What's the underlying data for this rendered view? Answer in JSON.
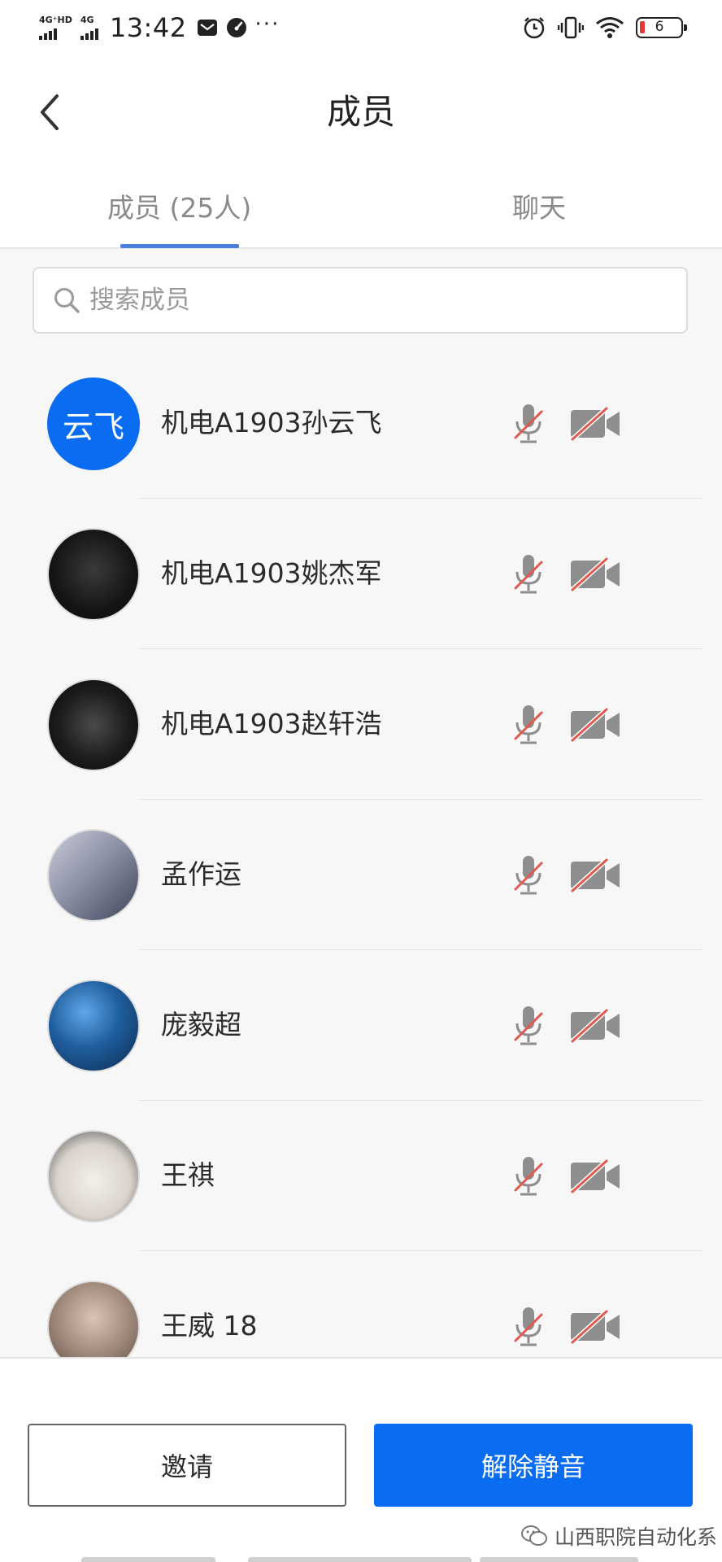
{
  "status_bar": {
    "net1": "4G⁺HD",
    "net2": "4G",
    "time": "13:42",
    "dots": "···",
    "battery": "6"
  },
  "header": {
    "title": "成员"
  },
  "tabs": [
    {
      "label": "成员 (25人)",
      "selected": true
    },
    {
      "label": "聊天",
      "selected": false
    }
  ],
  "search": {
    "placeholder": "搜索成员",
    "value": ""
  },
  "members": [
    {
      "name": "机电A1903孙云飞",
      "avatar_text": "云飞",
      "mic": "muted",
      "camera": "off"
    },
    {
      "name": "机电A1903姚杰军",
      "mic": "muted",
      "camera": "off"
    },
    {
      "name": "机电A1903赵轩浩",
      "mic": "muted",
      "camera": "off"
    },
    {
      "name": "孟作运",
      "mic": "muted",
      "camera": "off"
    },
    {
      "name": "庞毅超",
      "mic": "muted",
      "camera": "off"
    },
    {
      "name": "王祺",
      "mic": "muted",
      "camera": "off"
    },
    {
      "name": "王威  18",
      "mic": "muted",
      "camera": "off"
    }
  ],
  "footer": {
    "invite_label": "邀请",
    "unmute_label": "解除静音"
  },
  "watermark": "山西职院自动化系",
  "colors": {
    "accent": "#0a6cf1",
    "tab_indicator": "#4a7fe0",
    "muted_slash": "#e05a4f",
    "icon_gray": "#8e8e8e"
  }
}
